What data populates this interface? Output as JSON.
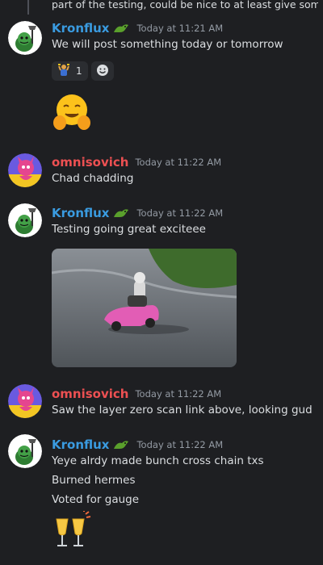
{
  "top_message": {
    "text": "part of the testing, could be nice to at least give something"
  },
  "messages": [
    {
      "author": "Kronflux",
      "timestamp": "Today at 11:21 AM",
      "lines": [
        "We will post something today or tomorrow"
      ],
      "reactions": [
        {
          "icon": "celebrate-person-emoji",
          "count": "1"
        },
        {
          "icon": "add-reaction-smile-icon"
        }
      ],
      "big_emoji": "hugging-face-emoji"
    },
    {
      "author": "omnisovich",
      "timestamp": "Today at 11:22 AM",
      "lines": [
        "Chad chadding"
      ]
    },
    {
      "author": "Kronflux",
      "timestamp": "Today at 11:22 AM",
      "lines": [
        "Testing going great exciteee"
      ],
      "attachment": "gif-pink-go-kart"
    },
    {
      "author": "omnisovich",
      "timestamp": "Today at 11:22 AM",
      "lines": [
        "Saw the layer zero scan link above, looking gud"
      ]
    },
    {
      "author": "Kronflux",
      "timestamp": "Today at 11:22 AM",
      "lines": [
        "Yeye alrdy made bunch cross chain txs",
        "Burned hermes",
        "Voted for gauge"
      ],
      "big_emoji": "clinking-glasses-emoji"
    }
  ],
  "colors": {
    "background": "#1e1f22",
    "kronflux_name": "#3a9be0",
    "omnisovich_name": "#ed5052",
    "timestamp": "#949ba4",
    "text": "#dbdee1",
    "reaction_bg": "#2b2d31"
  }
}
